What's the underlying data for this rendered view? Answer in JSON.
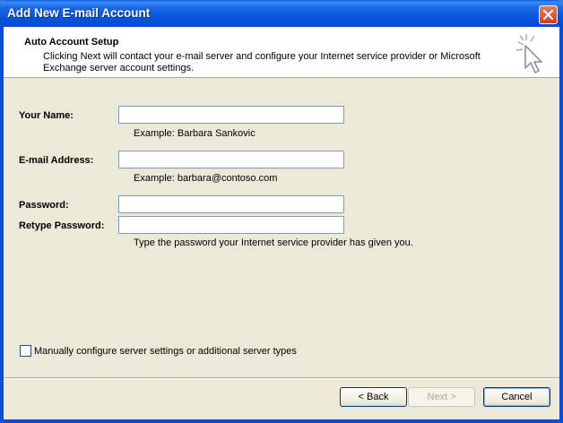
{
  "window": {
    "title": "Add New E-mail Account"
  },
  "header": {
    "title": "Auto Account Setup",
    "description": "Clicking Next will contact your e-mail server and configure your Internet service provider or Microsoft Exchange server account settings."
  },
  "form": {
    "name_label": "Your Name:",
    "name_value": "",
    "name_hint": "Example: Barbara Sankovic",
    "email_label": "E-mail Address:",
    "email_value": "",
    "email_hint": "Example: barbara@contoso.com",
    "password_label": "Password:",
    "retype_label": "Retype Password:",
    "password_hint": "Type the password your Internet service provider has given you."
  },
  "manual_config": {
    "label": "Manually configure server settings or additional server types",
    "checked": false
  },
  "buttons": {
    "back": "< Back",
    "next": "Next >",
    "cancel": "Cancel"
  },
  "colors": {
    "titlebar": "#0054dd",
    "client_bg": "#ece9d8",
    "close_button": "#d8542e"
  }
}
